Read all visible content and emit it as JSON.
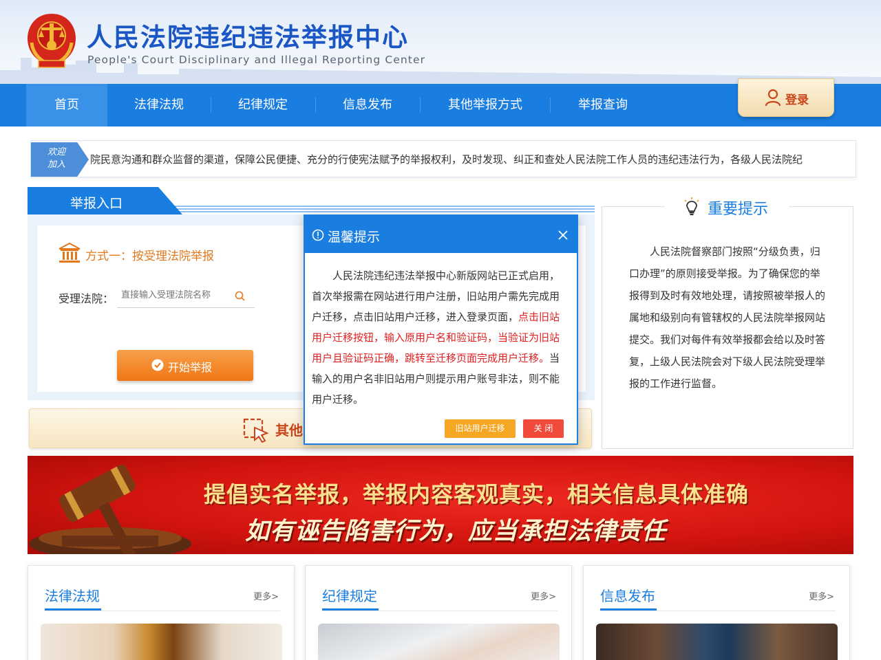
{
  "site": {
    "title": "人民法院违纪违法举报中心",
    "subtitle": "People's Court Disciplinary and Illegal Reporting Center"
  },
  "nav": {
    "items": [
      {
        "label": "首页",
        "active": true
      },
      {
        "label": "法律法规"
      },
      {
        "label": "纪律规定"
      },
      {
        "label": "信息发布"
      },
      {
        "label": "其他举报方式"
      },
      {
        "label": "举报查询"
      }
    ],
    "login_label": "登录"
  },
  "marquee": {
    "tag": "欢迎加入",
    "text": "院民意沟通和群众监督的渠道，保障公民便捷、充分的行使宪法赋予的举报权利，及时发现、纠正和查处人民法院工作人员的违纪违法行为，各级人民法院纪"
  },
  "report": {
    "tab_label": "举报入口",
    "method_label": "方式一：按受理法院举报",
    "court_label": "受理法院：",
    "court_placeholder": "直接输入受理法院名称",
    "start_button": "开始举报",
    "other_label": "其他"
  },
  "notice": {
    "title": "重要提示",
    "text": "人民法院督察部门按照“分级负责，归口办理”的原则接受举报。为了确保您的举报得到及时有效地处理，请按照被举报人的属地和级别向有管辖权的人民法院举报网站提交。我们对每件有效举报都会给以及时答复，上级人民法院会对下级人民法院受理举报的工作进行监督。"
  },
  "banner": {
    "line1": "提倡实名举报，举报内容客观真实，相关信息具体准确",
    "line2": "如有诬告陷害行为，应当承担法律责任"
  },
  "cards": [
    {
      "title": "法律法规",
      "more": "更多>"
    },
    {
      "title": "纪律规定",
      "more": "更多>"
    },
    {
      "title": "信息发布",
      "more": "更多>"
    }
  ],
  "modal": {
    "title": "温馨提示",
    "text_normal_1": "人民法院违纪违法举报中心新版网站已正式启用，首次举报需在网站进行用户注册，旧站用户需先完成用户迁移，点击旧站用户迁移，进入登录页面，",
    "text_red": "点击旧站用户迁移按钮，输入原用户名和验证码，当验证为旧站用户且验证码正确，跳转至迁移页面完成用户迁移。",
    "text_normal_2": "当输入的用户名非旧站用户则提示用户账号非法，则不能用户迁移。",
    "migrate_button": "旧站用户迁移",
    "close_button": "关 闭"
  },
  "colors": {
    "primary": "#1a7de0",
    "accent_orange": "#ef7614",
    "banner_red": "#d3140f",
    "alert_red": "#e02020"
  }
}
